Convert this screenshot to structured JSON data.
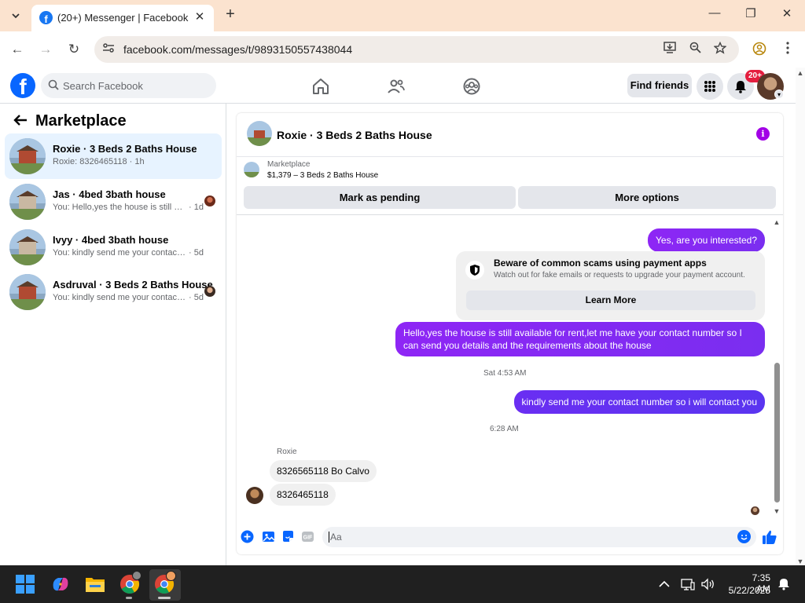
{
  "browser": {
    "tab_title": "(20+) Messenger | Facebook",
    "url": "facebook.com/messages/t/9893150557438044",
    "tab_list_icon": "chevron-down-icon",
    "close_tab_glyph": "✕",
    "new_tab_glyph": "+",
    "window_controls": {
      "minimize": "—",
      "maximize": "❐",
      "close": "✕"
    },
    "nav": {
      "back": "←",
      "forward": "→",
      "reload": "↻"
    },
    "omni_icons": [
      "site-settings-icon",
      "install-app-icon",
      "zoom-icon",
      "bookmark-star-icon",
      "profile-icon",
      "menu-icon"
    ]
  },
  "fb_nav": {
    "logo": "f",
    "search_placeholder": "Search Facebook",
    "find_friends": "Find friends",
    "notification_badge": "20+",
    "brand_color": "#0866ff"
  },
  "sidebar": {
    "title": "Marketplace",
    "conversations": [
      {
        "name": "Roxie · 3 Beds 2 Baths House",
        "snippet": "Roxie: 8326465118",
        "time": "1h",
        "active": true
      },
      {
        "name": "Jas · 4bed 3bath house",
        "snippet": "You: Hello,yes the house is still available for rent",
        "time": "1d",
        "active": false
      },
      {
        "name": "Ivyy · 4bed 3bath house",
        "snippet": "You: kindly send me your contact number so i will contact you",
        "time": "5d",
        "active": false
      },
      {
        "name": "Asdruval · 3 Beds 2 Baths House",
        "snippet": "You: kindly send me your contact number so i will contact you",
        "time": "5d",
        "active": false
      }
    ]
  },
  "chat": {
    "title": "Roxie · 3 Beds 2 Baths House",
    "marketplace_label": "Marketplace",
    "listing": "$1,379 – 3 Beds 2 Baths House",
    "mark_pending": "Mark as pending",
    "more_options": "More options",
    "accent": "#8a2be2",
    "messages": {
      "m1": "Yes, are you interested?",
      "scam_title": "Beware of common scams using payment apps",
      "scam_sub": "Watch out for fake emails or requests to upgrade your payment account.",
      "learn_more": "Learn More",
      "m2": "Hello,yes the house is still available for rent,let me have your contact number   so I can send you details and the requirements about the house",
      "ts1": "Sat 4:53 AM",
      "m3": "kindly send me your contact number so i will contact you",
      "ts2": "6:28 AM",
      "sender": "Roxie",
      "m4": "8326565118 Bo Calvo",
      "m5": "8326465118"
    },
    "composer_placeholder": "Aa"
  },
  "taskbar": {
    "time": "7:35 AM",
    "date": "5/22/2025"
  }
}
